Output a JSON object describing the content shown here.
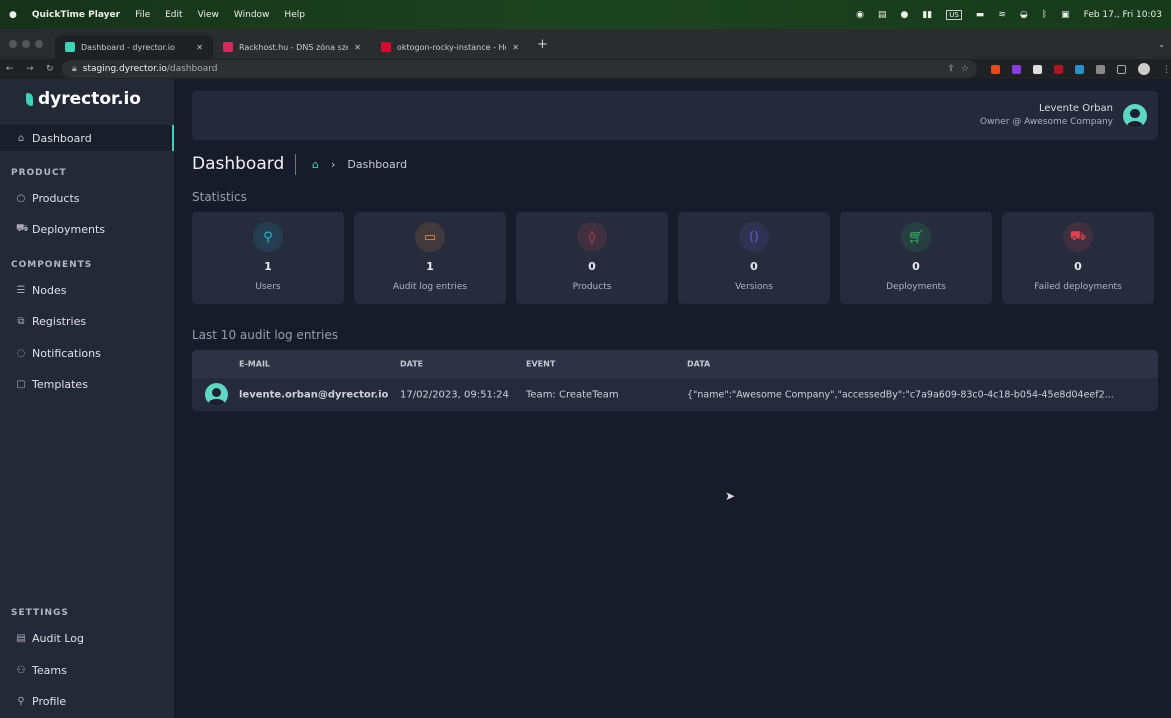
{
  "macos": {
    "app": "QuickTime Player",
    "menus": [
      "File",
      "Edit",
      "View",
      "Window",
      "Help"
    ],
    "keyboard": "US",
    "datetime": "Feb 17., Fri  10:03"
  },
  "browser": {
    "tabs": [
      {
        "title": "Dashboard - dyrector.io",
        "color": "#3dd3b8"
      },
      {
        "title": "Rackhost.hu - DNS zóna szerk",
        "color": "#d12a5c"
      },
      {
        "title": "oktogon-rocky-instance - Hetz",
        "color": "#d50c2d"
      }
    ],
    "url_host": "staging.dyrector.io",
    "url_path": "/dashboard"
  },
  "sidebar": {
    "logo": "dyrector.io",
    "dashboard": "Dashboard",
    "sections": [
      {
        "title": "PRODUCT",
        "items": [
          "Products",
          "Deployments"
        ]
      },
      {
        "title": "COMPONENTS",
        "items": [
          "Nodes",
          "Registries",
          "Notifications",
          "Templates"
        ]
      },
      {
        "title": "SETTINGS",
        "items": [
          "Audit Log",
          "Teams",
          "Profile"
        ]
      }
    ]
  },
  "header": {
    "user_name": "Levente Orban",
    "user_role": "Owner @ Awesome Company"
  },
  "page": {
    "title": "Dashboard",
    "breadcrumb": "Dashboard",
    "statistics_label": "Statistics",
    "audit_label": "Last 10 audit log entries"
  },
  "stats": [
    {
      "value": "1",
      "label": "Users",
      "icon": "user-icon",
      "color": "#22b8cf"
    },
    {
      "value": "1",
      "label": "Audit log entries",
      "icon": "message-icon",
      "color": "#f08c3a"
    },
    {
      "value": "0",
      "label": "Products",
      "icon": "drop-icon",
      "color": "#e0424f"
    },
    {
      "value": "0",
      "label": "Versions",
      "icon": "code-icon",
      "color": "#6a5ae0"
    },
    {
      "value": "0",
      "label": "Deployments",
      "icon": "cart-icon",
      "color": "#2fbf62"
    },
    {
      "value": "0",
      "label": "Failed deployments",
      "icon": "truck-icon",
      "color": "#e0424f"
    }
  ],
  "audit": {
    "columns": [
      "E-MAIL",
      "DATE",
      "EVENT",
      "DATA"
    ],
    "rows": [
      {
        "email": "levente.orban@dyrector.io",
        "date": "17/02/2023, 09:51:24",
        "event": "Team: CreateTeam",
        "data": "{\"name\":\"Awesome Company\",\"accessedBy\":\"c7a9a609-83c0-4c18-b054-45e8d04eef2..."
      }
    ]
  }
}
